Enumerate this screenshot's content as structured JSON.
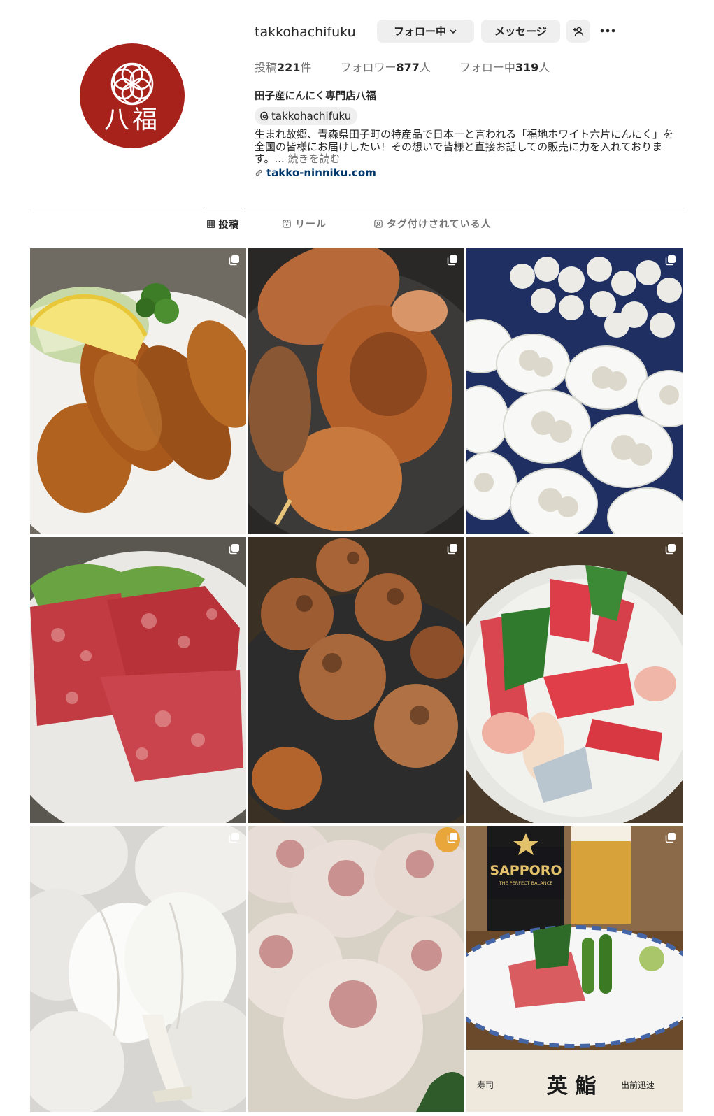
{
  "profile": {
    "username": "takkohachifuku",
    "avatar_text": "八福",
    "full_name": "田子産にんにく専門店八福",
    "threads_handle": "takkohachifuku",
    "bio": "生まれ故郷、青森県田子町の特産品で日本一と言われる「福地ホワイト六片にんにく」を全国の皆様にお届けしたい！その想いで皆様と直接お話しての販売に力を入れております。...",
    "bio_more": "続きを読む",
    "link": "takko-ninniku.com"
  },
  "buttons": {
    "following": "フォロー中",
    "message": "メッセージ"
  },
  "stats": {
    "posts_label": "投稿",
    "posts_value": "221",
    "posts_unit": "件",
    "followers_label": "フォロワー",
    "followers_value": "877",
    "followers_unit": "人",
    "following_label": "フォロー中",
    "following_value": "319",
    "following_unit": "人"
  },
  "tabs": {
    "posts": "投稿",
    "reels": "リール",
    "tagged": "タグ付けされている人"
  },
  "posts": [
    {
      "subject": "fried oysters with lemon and cabbage",
      "multi": true
    },
    {
      "subject": "grilled chicken skewer",
      "multi": true
    },
    {
      "subject": "garlic bulbs on white paper plates",
      "multi": true
    },
    {
      "subject": "marbled raw wagyu beef",
      "multi": true
    },
    {
      "subject": "grilled tsukune meatballs with miso",
      "multi": true
    },
    {
      "subject": "sashimi platter",
      "multi": true
    },
    {
      "subject": "white garlic bulbs close-up",
      "multi": true
    },
    {
      "subject": "shumai dumplings",
      "multi": true
    },
    {
      "subject": "sashimi with beer and Sapporo bottle",
      "multi": true
    }
  ],
  "photo_texts": {
    "sapporo": "SAPPORO",
    "sapporo_sub": "THE PERFECT BALANCE",
    "chopstick_name": "英 鮨",
    "chopstick_left": "寿司",
    "chopstick_right": "出前迅速"
  },
  "colors": {
    "avatar_bg": "#a8221c",
    "link": "#00376b",
    "button_bg": "#efefef",
    "muted_text": "#737373"
  }
}
